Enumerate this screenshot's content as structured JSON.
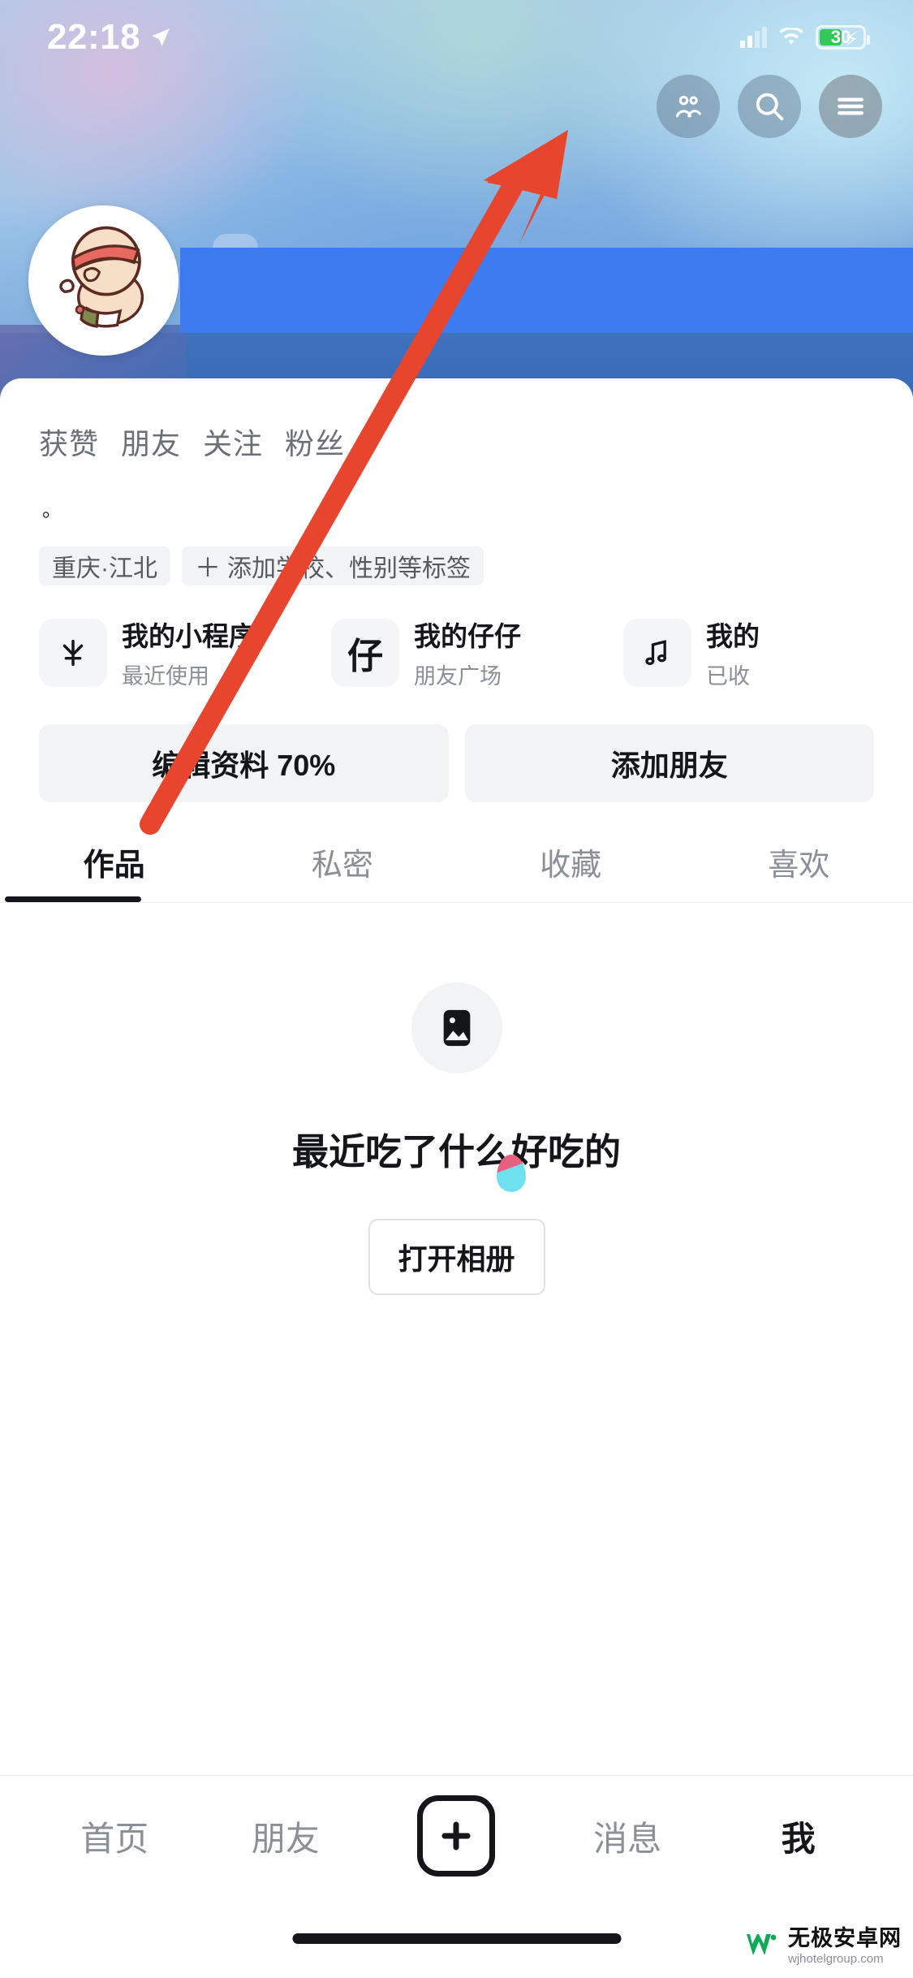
{
  "status_bar": {
    "time": "22:18",
    "location_icon": "location-arrow-icon",
    "signal_icon": "cellular-signal-icon",
    "wifi_icon": "wifi-icon",
    "battery_percent": "30",
    "battery_charging": true
  },
  "header": {
    "buttons": [
      {
        "name": "friends-button",
        "icon": "two-people-icon"
      },
      {
        "name": "search-button",
        "icon": "search-icon"
      },
      {
        "name": "menu-button",
        "icon": "hamburger-menu-icon"
      }
    ],
    "avatar_alt": "cartoon-baby-with-red-headband-avatar"
  },
  "profile": {
    "stats": [
      {
        "label": "获赞"
      },
      {
        "label": "朋友"
      },
      {
        "label": "关注"
      },
      {
        "label": "粉丝"
      }
    ],
    "signature": "。",
    "tags": [
      {
        "label": "重庆·江北",
        "has_plus": false
      },
      {
        "label": "添加学校、性别等标签",
        "has_plus": true
      }
    ]
  },
  "mini_cards": [
    {
      "icon_glyph": "火",
      "icon_name": "mini-program-icon",
      "title": "我的小程序",
      "subtitle": "最近使用"
    },
    {
      "icon_glyph": "仔",
      "icon_name": "zaizai-icon",
      "title": "我的仔仔",
      "subtitle": "朋友广场"
    },
    {
      "icon_glyph": "♫",
      "icon_name": "music-note-icon",
      "title": "我的",
      "subtitle": "已收"
    }
  ],
  "actions": [
    {
      "label": "编辑资料 70%"
    },
    {
      "label": "添加朋友"
    }
  ],
  "content_tabs": [
    {
      "label": "作品",
      "active": true
    },
    {
      "label": "私密",
      "active": false
    },
    {
      "label": "收藏",
      "active": false
    },
    {
      "label": "喜欢",
      "active": false
    }
  ],
  "empty_state": {
    "icon": "image-placeholder-icon",
    "title": "最近吃了什么好吃的",
    "button_label": "打开相册"
  },
  "bottom_nav": [
    {
      "label": "首页",
      "active": false
    },
    {
      "label": "朋友",
      "active": false
    },
    {
      "label": "+",
      "active": false,
      "is_plus": true
    },
    {
      "label": "消息",
      "active": false
    },
    {
      "label": "我",
      "active": true
    }
  ],
  "watermark": {
    "main": "无极安卓网",
    "sub": "wjhotelgroup.com"
  },
  "colors": {
    "accent_blue": "#3d7bf0",
    "cover_blue": "#2e63b2",
    "text_primary": "#15161a",
    "text_secondary": "#8b8f96",
    "chip_bg": "#f2f3f5",
    "annotation_red": "#e8452f",
    "battery_green": "#34c759"
  }
}
